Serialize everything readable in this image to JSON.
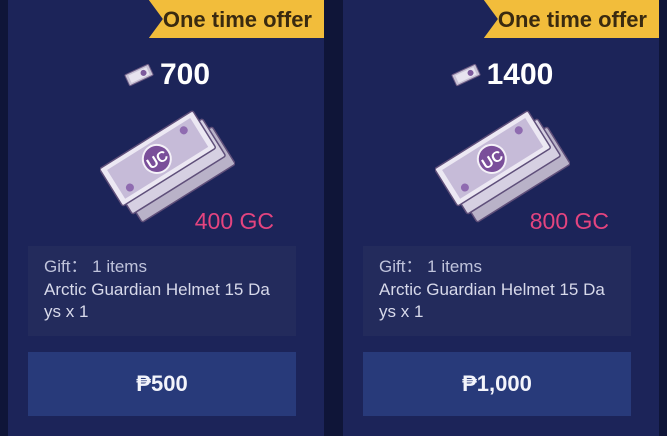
{
  "offers": [
    {
      "badge": "One time offer",
      "amount": "700",
      "gc": "400 GC",
      "gift_label": "Gift： 1 items",
      "gift_line1": "Arctic Guardian Helmet 15 Da",
      "gift_line2": "ys x 1",
      "price": "₱500",
      "icon": "uc-voucher-icon",
      "bundle_icon": "uc-voucher-bundle-icon"
    },
    {
      "badge": "One time offer",
      "amount": "1400",
      "gc": "800 GC",
      "gift_label": "Gift： 1 items",
      "gift_line1": "Arctic Guardian Helmet 15 Da",
      "gift_line2": "ys x 1",
      "price": "₱1,000",
      "icon": "uc-voucher-icon",
      "bundle_icon": "uc-voucher-bundle-icon"
    }
  ],
  "colors": {
    "background": "#0f1538",
    "card": "#1c2459",
    "badge": "#f2bd3b",
    "gc_text": "#e4447f",
    "button": "#283a7a"
  }
}
